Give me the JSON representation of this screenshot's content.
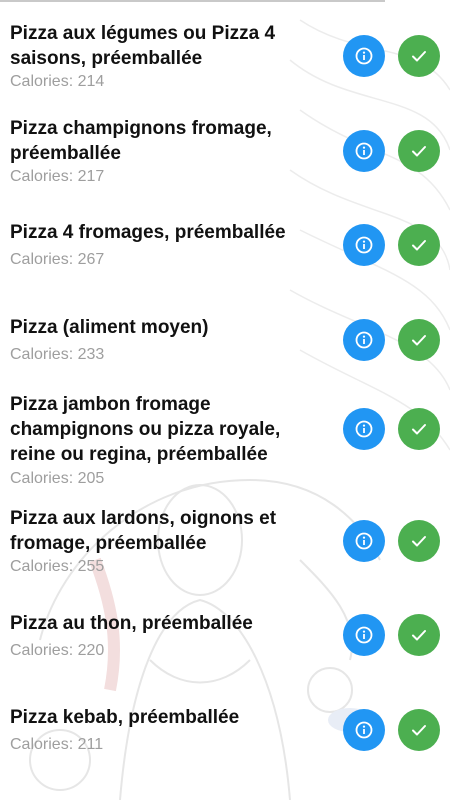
{
  "calories_prefix": "Calories: ",
  "icons": {
    "info": "info-circle-icon",
    "add": "checkmark-icon"
  },
  "colors": {
    "info_button": "#2196f3",
    "add_button": "#4caf50",
    "calorie_text": "#9e9e9e"
  },
  "items": [
    {
      "name": "Pizza aux légumes ou Pizza 4 saisons, préemballée",
      "calories_label": "Calories: 214"
    },
    {
      "name": "Pizza champignons fromage, préemballée",
      "calories_label": "Calories: 217"
    },
    {
      "name": "Pizza 4 fromages, préemballée",
      "calories_label": "Calories: 267"
    },
    {
      "name": "Pizza (aliment moyen)",
      "calories_label": "Calories: 233"
    },
    {
      "name": "Pizza jambon fromage champignons ou pizza royale, reine ou regina, préemballée",
      "calories_label": "Calories: 205"
    },
    {
      "name": "Pizza aux lardons, oignons et fromage, préemballée",
      "calories_label": "Calories: 255"
    },
    {
      "name": "Pizza au thon, préemballée",
      "calories_label": "Calories: 220"
    },
    {
      "name": "Pizza kebab, préemballée",
      "calories_label": "Calories: 211"
    }
  ]
}
